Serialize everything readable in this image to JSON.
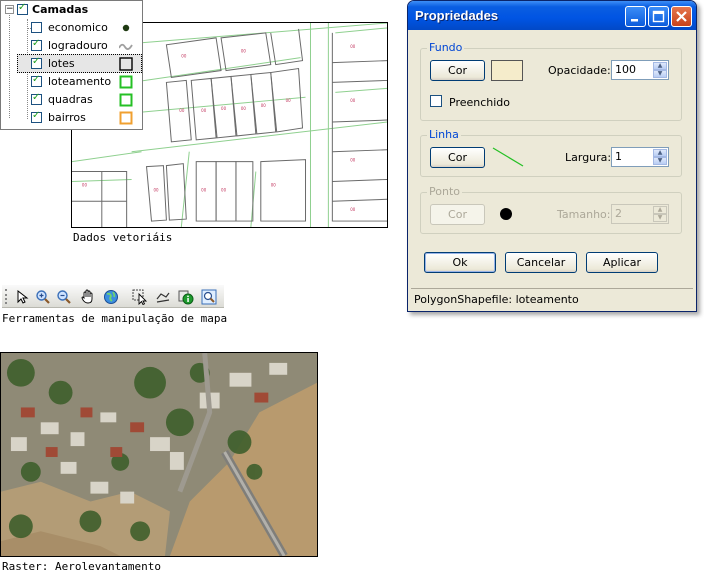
{
  "layers": {
    "root_label": "Camadas",
    "items": [
      {
        "label": "economico",
        "checked": false,
        "symbol": "point",
        "color": "#1f3a12"
      },
      {
        "label": "logradouro",
        "checked": true,
        "symbol": "wave",
        "color": "#a0a0a0"
      },
      {
        "label": "lotes",
        "checked": true,
        "symbol": "square",
        "color": "#000000",
        "selected": true
      },
      {
        "label": "loteamento",
        "checked": true,
        "symbol": "square",
        "color": "#25c025"
      },
      {
        "label": "quadras",
        "checked": true,
        "symbol": "square",
        "color": "#25c025"
      },
      {
        "label": "bairros",
        "checked": true,
        "symbol": "square",
        "color": "#f0a030"
      }
    ]
  },
  "captions": {
    "vector": "Dados vetoriáis",
    "toolbar": "Ferramentas de manipulação de mapa",
    "raster": "Raster: Aerolevantamento"
  },
  "toolbar": {
    "tools": [
      "pointer-icon",
      "zoom-in-icon",
      "zoom-out-icon",
      "pan-hand-icon",
      "globe-icon",
      "select-feature-icon",
      "measure-icon",
      "info-icon",
      "zoom-extent-icon"
    ]
  },
  "dialog": {
    "title": "Propriedades",
    "fundo": {
      "legend": "Fundo",
      "color_button": "Cor",
      "swatch_color": "#f5eccb",
      "opacity_label": "Opacidade:",
      "opacity_value": "100",
      "filled_label": "Preenchido",
      "filled_checked": false
    },
    "linha": {
      "legend": "Linha",
      "color_button": "Cor",
      "line_color": "#25c025",
      "width_label": "Largura:",
      "width_value": "1"
    },
    "ponto": {
      "legend": "Ponto",
      "color_button": "Cor",
      "size_label": "Tamanho:",
      "size_value": "2",
      "disabled": true
    },
    "buttons": {
      "ok": "Ok",
      "cancel": "Cancelar",
      "apply": "Aplicar"
    },
    "status": "PolygonShapefile:  loteamento"
  }
}
